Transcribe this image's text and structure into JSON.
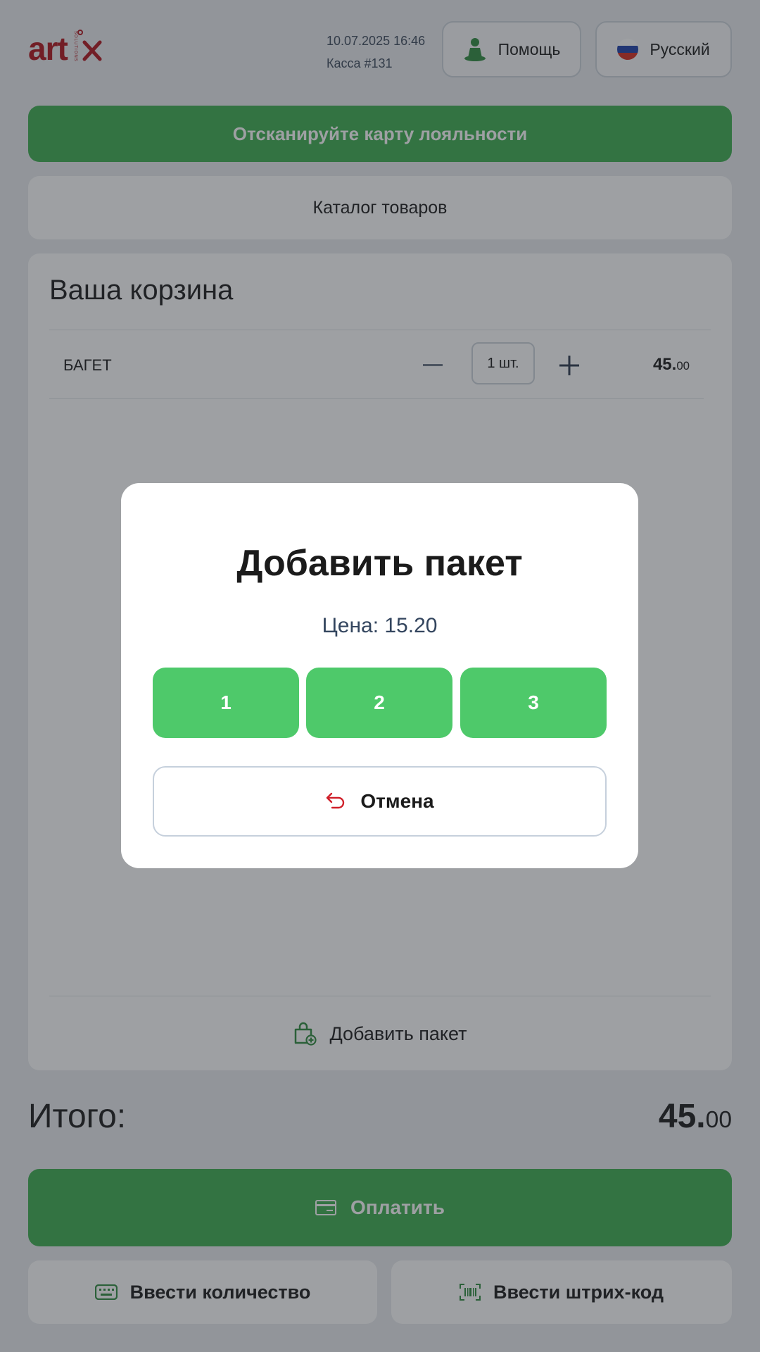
{
  "header": {
    "logo_text": "art",
    "logo_sub": "SOLUTIONS",
    "datetime": "10.07.2025 16:46",
    "register": "Касса #131",
    "help_label": "Помощь",
    "language_label": "Русский"
  },
  "loyalty": {
    "label": "Отсканируйте карту лояльности"
  },
  "catalog": {
    "label": "Каталог товаров"
  },
  "cart": {
    "title": "Ваша корзина",
    "items": [
      {
        "name": "БАГЕТ",
        "qty": "1 шт.",
        "price_main": "45.",
        "price_cents": "00"
      }
    ],
    "add_bag_label": "Добавить пакет"
  },
  "total": {
    "label": "Итого:",
    "amount_main": "45.",
    "amount_cents": "00"
  },
  "pay": {
    "label": "Оплатить"
  },
  "actions": {
    "enter_qty": "Ввести количество",
    "enter_barcode": "Ввести штрих-код"
  },
  "modal": {
    "title": "Добавить пакет",
    "price": "Цена: 15.20",
    "options": [
      "1",
      "2",
      "3"
    ],
    "cancel_label": "Отмена"
  },
  "colors": {
    "brand_red": "#b0131d",
    "accent_green": "#3cae4f",
    "modal_green": "#4ec96a"
  },
  "icons": {
    "help": "person-help-icon",
    "language": "russia-flag-icon",
    "bag": "shopping-bag-plus-icon",
    "pay": "credit-card-icon",
    "qty": "keyboard-icon",
    "barcode": "barcode-scan-icon",
    "cancel": "undo-arrow-icon"
  }
}
